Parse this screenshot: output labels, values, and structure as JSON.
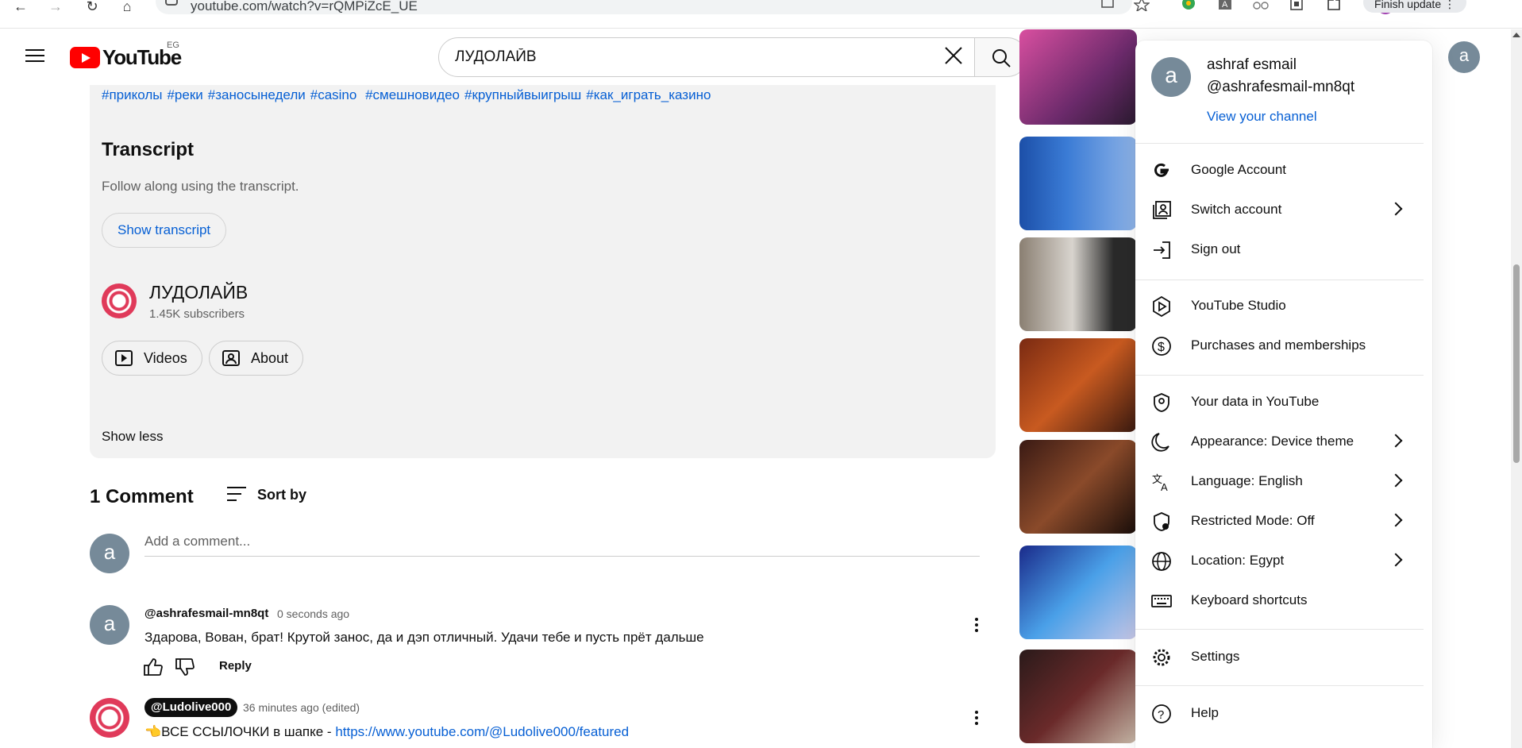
{
  "browser": {
    "url": "youtube.com/watch?v=rQMPiZcE_UE",
    "update_label": "Finish update",
    "profile_letter": "a"
  },
  "header": {
    "logo_text": "YouTube",
    "country_code": "EG",
    "search_value": "ЛУДОЛАЙВ",
    "avatar_letter": "a"
  },
  "description": {
    "hashtags": [
      "#приколы",
      "#реки",
      "#заносынедели",
      "#casino",
      " #смешновидео",
      "#крупныйвыигрыш",
      "#как_играть_казино"
    ],
    "transcript_title": "Transcript",
    "transcript_sub": "Follow along using the transcript.",
    "show_transcript_label": "Show transcript",
    "channel_name": "ЛУДОЛАЙВ",
    "channel_subs": "1.45K subscribers",
    "videos_label": "Videos",
    "about_label": "About",
    "show_less_label": "Show less"
  },
  "comments": {
    "count_label": "1 Comment",
    "sort_label": "Sort by",
    "add_placeholder": "Add a comment...",
    "user_avatar_letter": "a",
    "items": [
      {
        "author": "@ashrafesmail-mn8qt",
        "time": "0 seconds ago",
        "text": "Здарова, Вован, брат! Крутой занос, да и дэп отличный. Удачи тебе и пусть прёт дальше",
        "reply_label": "Reply"
      },
      {
        "author": "@Ludolive000",
        "time": "36 minutes ago (edited)",
        "text_prefix": "👈ВСЕ ССЫЛОЧКИ в шапке - ",
        "link": "https://www.youtube.com/@Ludolive000/featured"
      }
    ]
  },
  "account_menu": {
    "avatar_letter": "a",
    "name": "ashraf esmail",
    "handle": "@ashrafesmail-mn8qt",
    "view_channel_label": "View your channel",
    "items": [
      {
        "label": "Google Account",
        "icon": "google-icon"
      },
      {
        "label": "Switch account",
        "icon": "switch-account-icon"
      },
      {
        "label": "Sign out",
        "icon": "sign-out-icon"
      },
      {
        "label": "YouTube Studio",
        "icon": "studio-icon"
      },
      {
        "label": "Purchases and memberships",
        "icon": "dollar-icon"
      },
      {
        "label": "Your data in YouTube",
        "icon": "shield-person-icon"
      },
      {
        "label": "Appearance: Device theme",
        "icon": "moon-icon"
      },
      {
        "label": "Language: English",
        "icon": "translate-icon"
      },
      {
        "label": "Restricted Mode: Off",
        "icon": "restricted-icon"
      },
      {
        "label": "Location: Egypt",
        "icon": "globe-icon"
      },
      {
        "label": "Keyboard shortcuts",
        "icon": "keyboard-icon"
      },
      {
        "label": "Settings",
        "icon": "gear-icon"
      },
      {
        "label": "Help",
        "icon": "help-icon"
      }
    ]
  },
  "colors": {
    "brand_red": "#ff0000",
    "link_blue": "#065fd4",
    "panel_grey": "#f2f2f2"
  }
}
